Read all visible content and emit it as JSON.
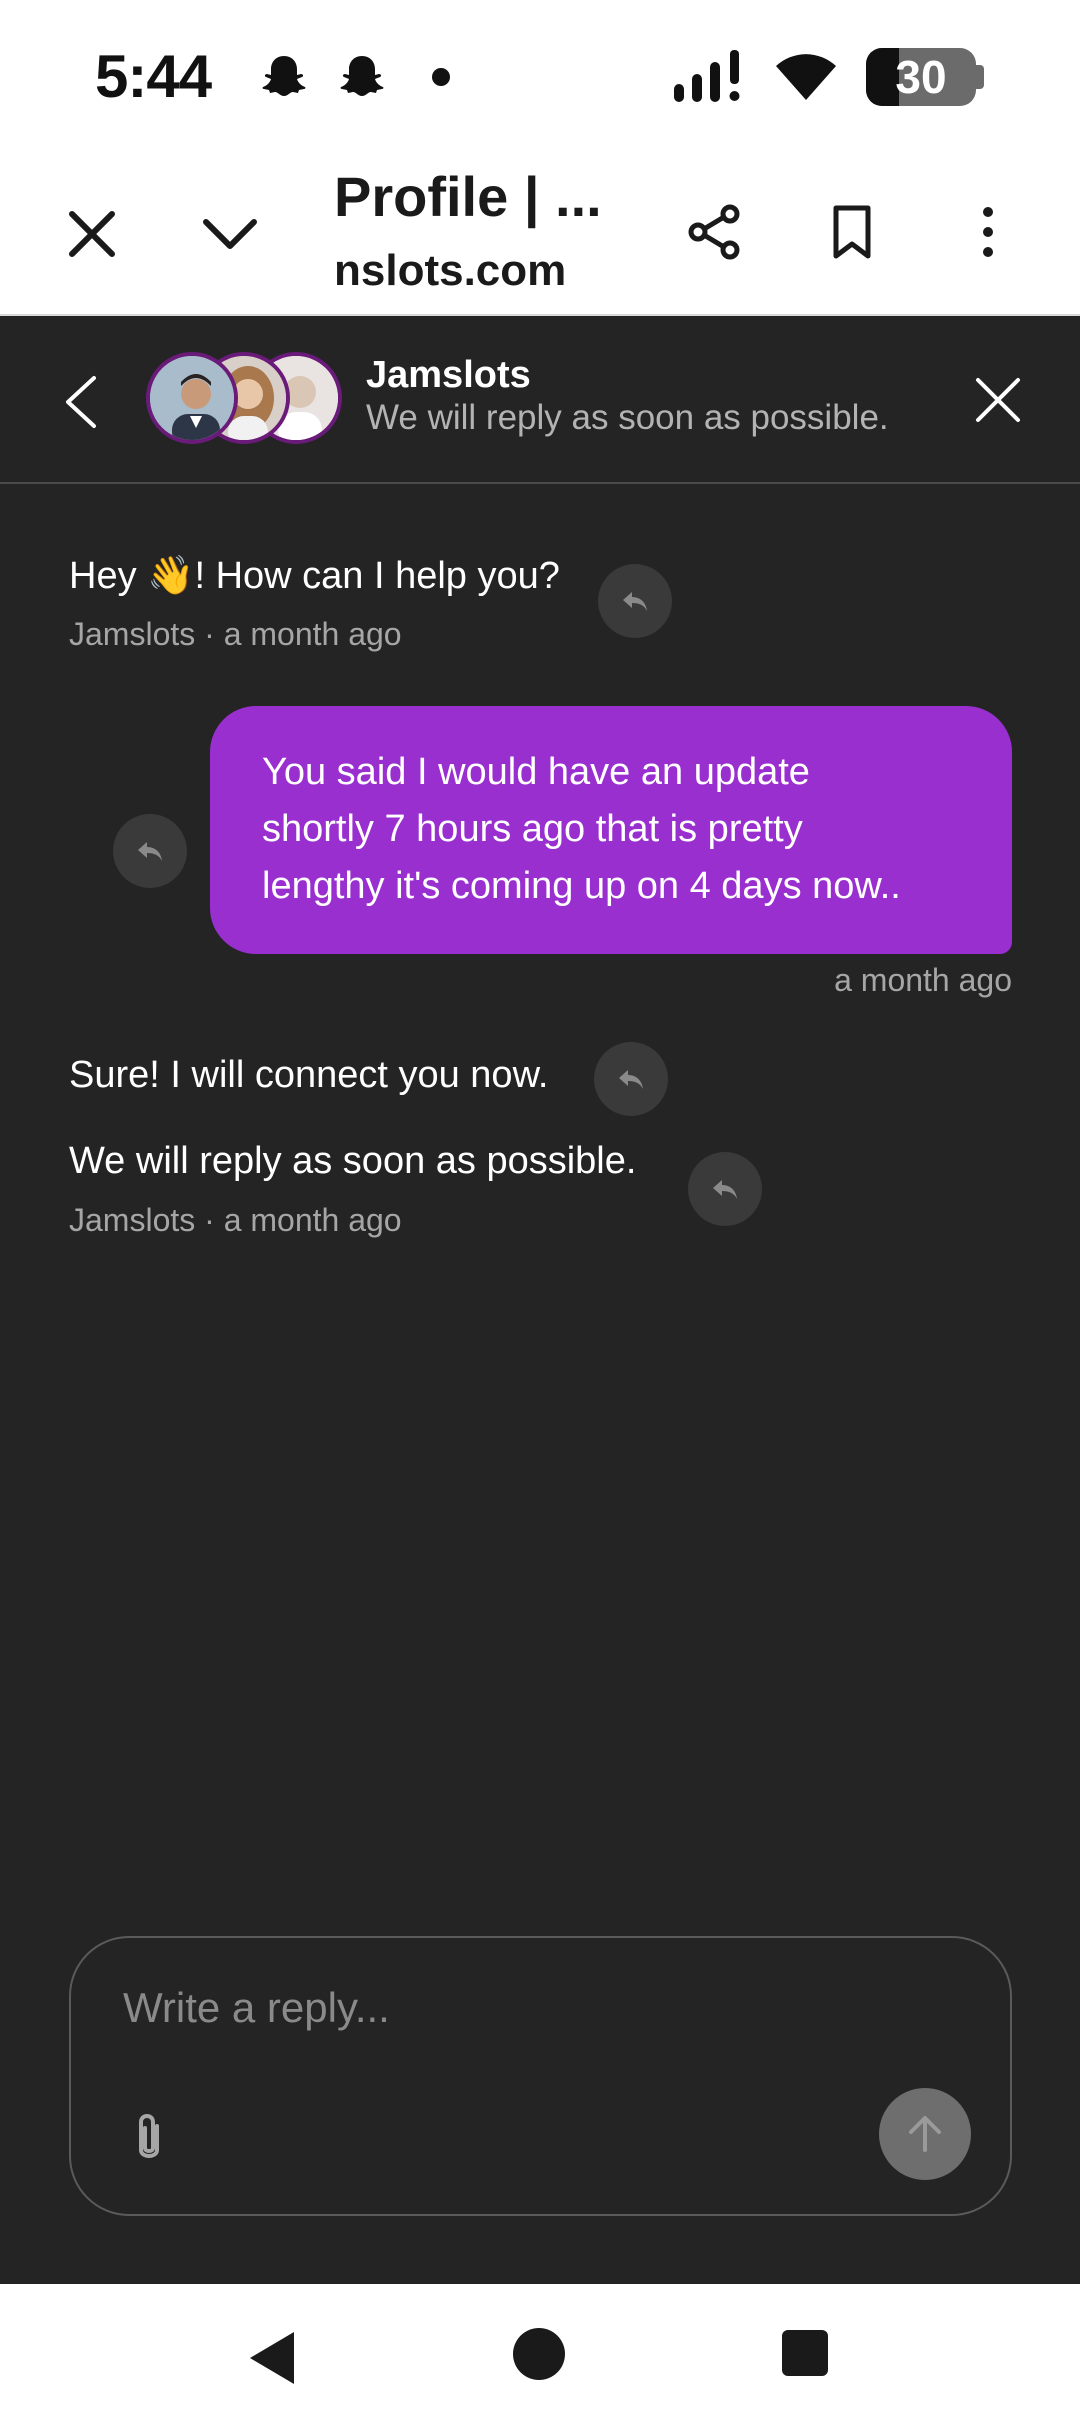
{
  "status_bar": {
    "time": "5:44",
    "battery": "30",
    "battery_level": 0.3,
    "icons": [
      "snapchat-icon",
      "snapchat-icon",
      "notification-dot",
      "signal-icon",
      "wifi-icon",
      "battery-icon"
    ]
  },
  "browser": {
    "page_title": "Profile | ...",
    "url": "nslots.com",
    "icons": [
      "close-icon",
      "chevron-down-icon",
      "share-icon",
      "bookmark-icon",
      "more-vert-icon"
    ]
  },
  "chat": {
    "brand_name": "Jamslots",
    "brand_sub": "We will reply as soon as possible.",
    "messages": {
      "m1": {
        "text_before": "Hey ",
        "emoji": "👋",
        "text_after": "! How can I help you?",
        "meta": "Jamslots · a month ago"
      },
      "m2": {
        "lines": [
          "You said I would have an update",
          "shortly 7 hours ago that is pretty",
          "lengthy it's coming up on 4 days now.."
        ],
        "meta": "a month ago"
      },
      "m3": {
        "text": "Sure! I will connect you now."
      },
      "m4": {
        "text": "We will reply as soon as possible.",
        "meta": "Jamslots · a month ago"
      }
    }
  },
  "composer": {
    "placeholder": "Write a reply..."
  },
  "colors": {
    "chat_bg": "#242424",
    "bubble": "#9a2fd0",
    "avatar_ring": "#6a1b7a"
  }
}
